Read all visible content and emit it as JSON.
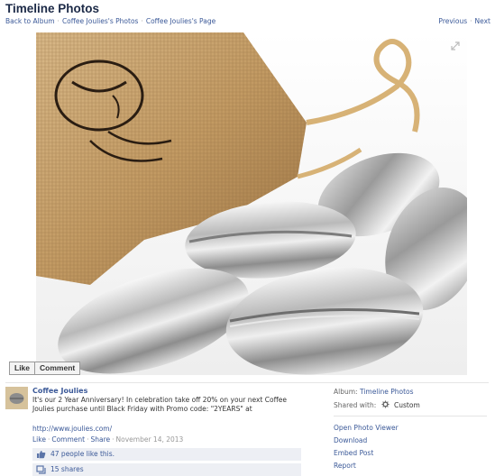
{
  "page": {
    "title": "Timeline Photos",
    "breadcrumbs": [
      "Back to Album",
      "Coffee Joulies's Photos",
      "Coffee Joulies's Page"
    ],
    "nav": {
      "previous": "Previous",
      "next": "Next"
    }
  },
  "photo": {
    "alt": "Stainless steel coffee bean shaped Coffee Joulies spilling out of a burlap bag"
  },
  "buttons": {
    "like": "Like",
    "comment": "Comment"
  },
  "post": {
    "author": "Coffee Joulies",
    "caption": "It's our 2 Year Anniversary! In celebration take off 20% on your next Coffee Joulies purchase until Black Friday with Promo code: \"2YEARS\" at",
    "link": "http://www.joulies.com/",
    "actions": {
      "like": "Like",
      "comment": "Comment",
      "share": "Share"
    },
    "date": "November 14, 2013",
    "likes_text": "47 people like this.",
    "shares_text": "15 shares"
  },
  "sidebar": {
    "album_label": "Album:",
    "album_value": "Timeline Photos",
    "shared_label": "Shared with:",
    "shared_value": "Custom",
    "links": [
      "Open Photo Viewer",
      "Download",
      "Embed Post",
      "Report"
    ]
  },
  "colors": {
    "link": "#3b5998",
    "title": "#1c2a47",
    "panel": "#edeff4"
  }
}
